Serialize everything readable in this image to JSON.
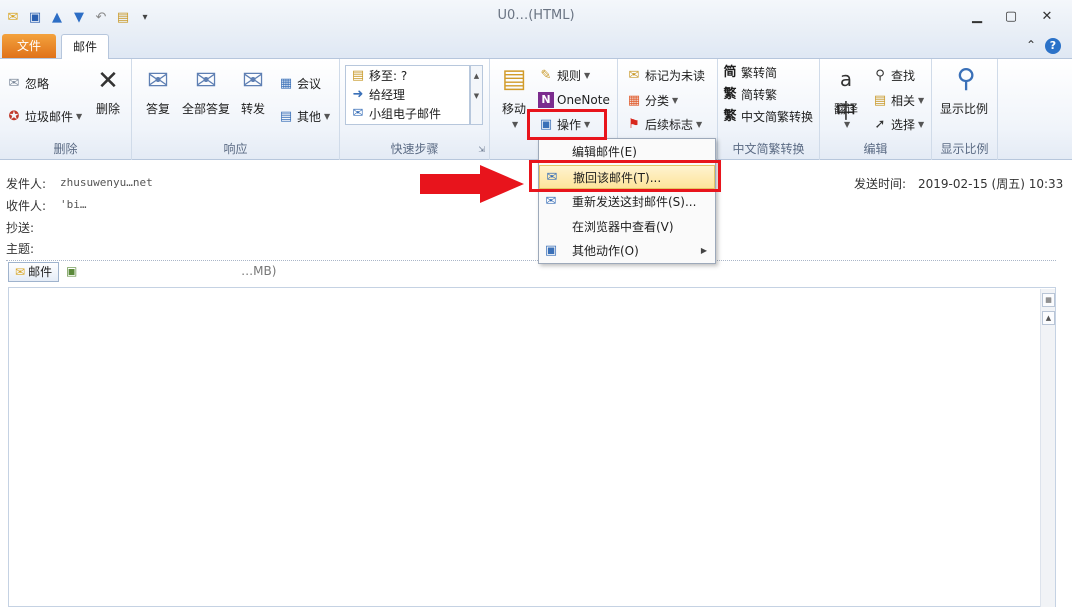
{
  "window": {
    "title": "U0…(HTML)",
    "controls": {
      "minimize": "▁",
      "maximize": "▢",
      "close": "✕"
    }
  },
  "qat": {
    "icons": [
      "mail-icon",
      "save-icon",
      "up-arrow-icon",
      "down-arrow-icon",
      "undo-icon",
      "folder-icon",
      "customize-icon"
    ]
  },
  "tabs": {
    "file": "文件",
    "mail": "邮件"
  },
  "ribbon": {
    "delete_group": {
      "label": "删除",
      "ignore": "忽略",
      "junk": "垃圾邮件",
      "delete": "删除"
    },
    "respond_group": {
      "label": "响应",
      "reply": "答复",
      "reply_all": "全部答复",
      "forward": "转发",
      "meeting": "会议",
      "other": "其他"
    },
    "quick_steps": {
      "label": "快速步骤",
      "items": [
        "移至: ?",
        "给经理",
        "小组电子邮件"
      ]
    },
    "move_group": {
      "move": "移动",
      "rules": "规则",
      "onenote": "OneNote",
      "actions": "操作"
    },
    "tags_group": {
      "mark_unread": "标记为未读",
      "categorize": "分类",
      "follow_up": "后续标志"
    },
    "chinese_group": {
      "label": "中文简繁转换",
      "to_simplified": "繁转简",
      "to_traditional": "简转繁",
      "convert": "中文简繁转换"
    },
    "edit_group": {
      "label": "编辑",
      "translate": "翻译",
      "find": "查找",
      "related": "相关",
      "select": "选择"
    },
    "zoom_group": {
      "label": "显示比例",
      "zoom": "显示比例"
    }
  },
  "actions_menu": {
    "items": [
      {
        "label": "编辑邮件(E)",
        "highlighted": false,
        "icon": ""
      },
      {
        "label": "撤回该邮件(T)...",
        "highlighted": true,
        "icon": "recall-icon"
      },
      {
        "label": "重新发送这封邮件(S)...",
        "highlighted": false,
        "icon": "resend-icon"
      },
      {
        "label": "在浏览器中查看(V)",
        "highlighted": false,
        "icon": ""
      },
      {
        "label": "其他动作(O)",
        "highlighted": false,
        "icon": "other-actions-icon",
        "submenu": true
      }
    ]
  },
  "headers": {
    "from_label": "发件人:",
    "from_value": "zhusuwenyu…net",
    "to_label": "收件人:",
    "to_value": "'bi…",
    "cc_label": "抄送:",
    "subject_label": "主题:",
    "sent_label": "发送时间:",
    "sent_value": "2019-02-15 (周五) 10:33",
    "mail_tab": "邮件",
    "attachment": "…MB)"
  },
  "colors": {
    "accent_red": "#e8141c",
    "file_tab": "#e0721a",
    "highlight": "#fde49a"
  }
}
